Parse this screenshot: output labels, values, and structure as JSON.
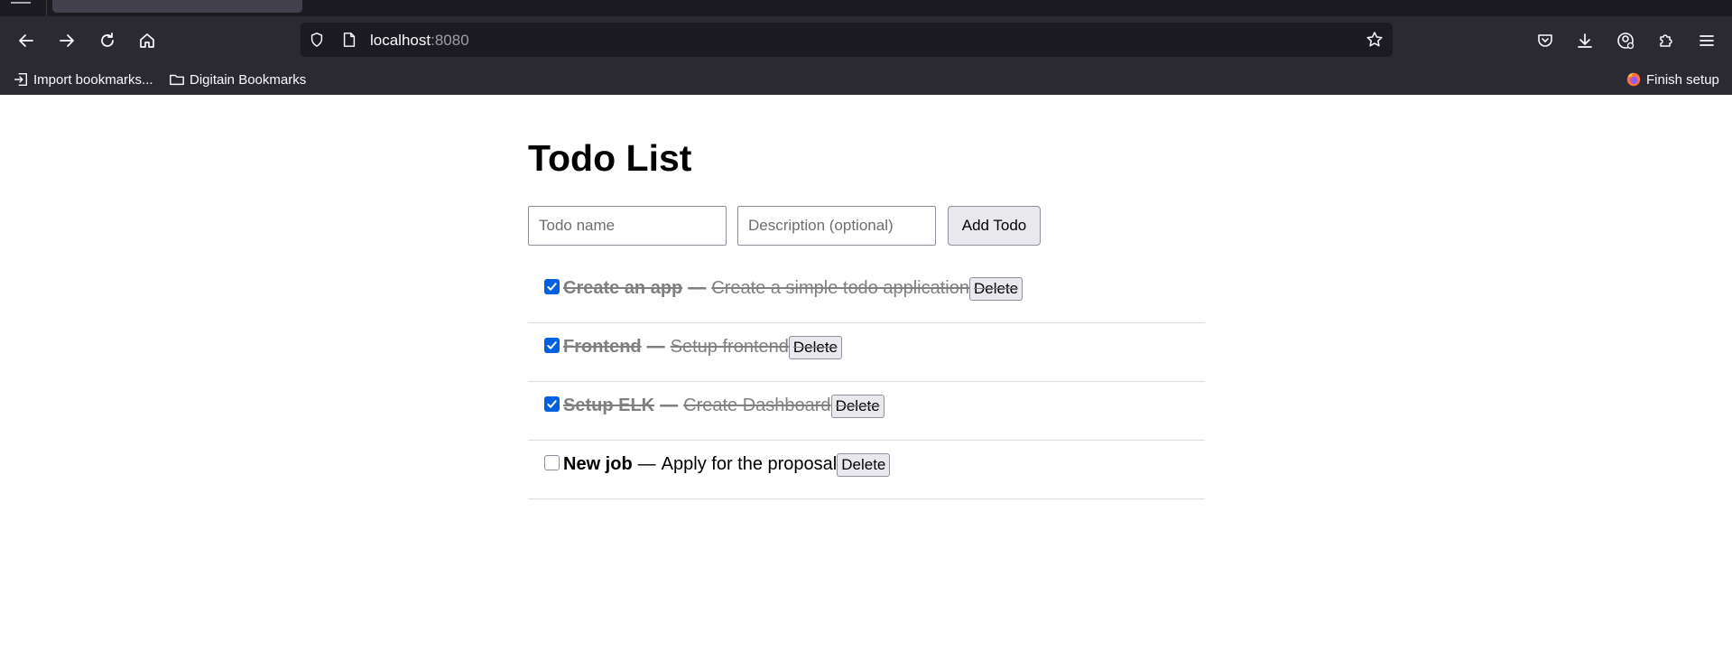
{
  "browser": {
    "url_host": "localhost",
    "url_port": ":8080",
    "bookmarks": [
      {
        "label": "Import bookmarks...",
        "icon": "import-icon"
      },
      {
        "label": "Digitain Bookmarks",
        "icon": "folder-icon"
      }
    ],
    "finish_setup": "Finish setup"
  },
  "page": {
    "title": "Todo List",
    "name_placeholder": "Todo name",
    "description_placeholder": "Description (optional)",
    "add_button": "Add Todo",
    "separator": "—",
    "delete_label": "Delete",
    "todos": [
      {
        "name": "Create an app",
        "description": "Create a simple todo application",
        "completed": true
      },
      {
        "name": "Frontend",
        "description": "Setup frontend",
        "completed": true
      },
      {
        "name": "Setup ELK",
        "description": "Create Dashboard",
        "completed": true
      },
      {
        "name": "New job",
        "description": "Apply for the proposal",
        "completed": false
      }
    ]
  },
  "colors": {
    "chrome_dark": "#2b2a33",
    "urlbar": "#1c1b22",
    "checkbox_accent": "#0060df",
    "completed_text": "#808080"
  }
}
